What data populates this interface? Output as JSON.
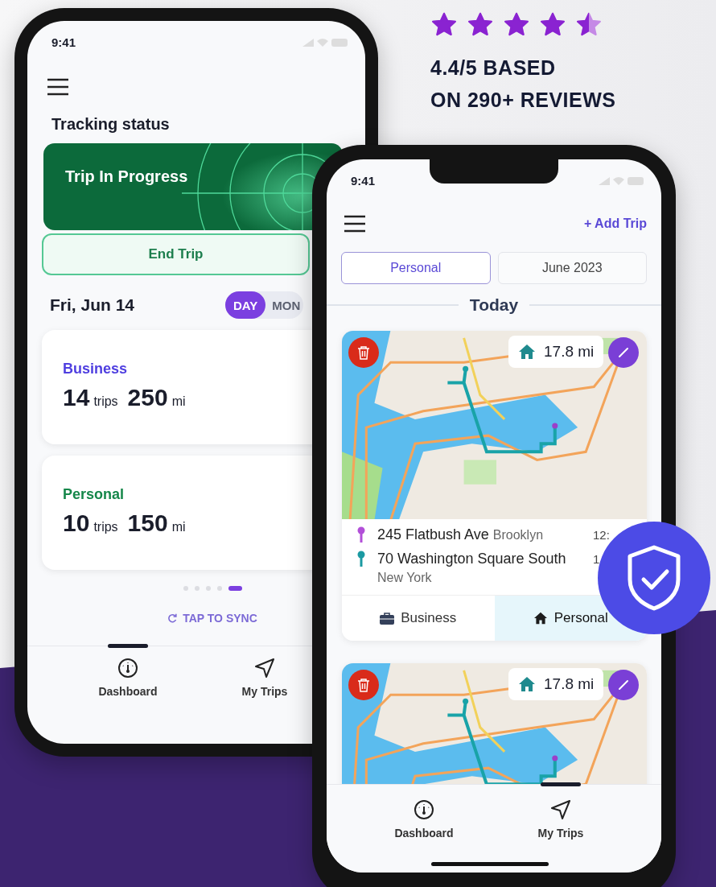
{
  "rating": {
    "stars": 4.5,
    "lines": [
      "4.4/5 BASED",
      "ON 290+ REVIEWS"
    ]
  },
  "dashboard_phone": {
    "time": "9:41",
    "section_title": "Tracking status",
    "status_card": {
      "label": "Trip In Progress"
    },
    "end_button": "End Trip",
    "date": "Fri, Jun 14",
    "period_toggle": [
      {
        "label": "DAY",
        "selected": true
      },
      {
        "label": "MON",
        "selected": false
      }
    ],
    "summaries": [
      {
        "category": "Business",
        "color": "#4f3fe0",
        "trips": "14",
        "trips_unit": "trips",
        "miles": "250",
        "miles_unit": "mi"
      },
      {
        "category": "Personal",
        "color": "#15874a",
        "trips": "10",
        "trips_unit": "trips",
        "miles": "150",
        "miles_unit": "mi"
      }
    ],
    "pager": [
      {
        "selected": false
      },
      {
        "selected": false
      },
      {
        "selected": false
      },
      {
        "selected": false
      },
      {
        "selected": true
      }
    ],
    "sync": "TAP TO SYNC",
    "nav": [
      {
        "label": "Dashboard",
        "kind": "gauge",
        "selected": true
      },
      {
        "label": "My Trips",
        "kind": "arrow",
        "selected": false
      }
    ]
  },
  "trips_phone": {
    "time": "9:41",
    "add_button": "+ Add Trip",
    "filters": [
      {
        "label": "Personal",
        "selected": true
      },
      {
        "label": "June 2023",
        "selected": false
      }
    ],
    "day_heading": "Today",
    "trips": [
      {
        "distance": "17.8 mi",
        "stops": [
          {
            "address": "245 Flatbush Ave",
            "city": "Brooklyn",
            "time": "12:",
            "color": "#b24fd8"
          },
          {
            "address": "70 Washington Square South",
            "city": "New York",
            "time": "1",
            "color": "#1b9aa2"
          }
        ],
        "categories": [
          {
            "label": "Business",
            "kind": "briefcase",
            "selected": false
          },
          {
            "label": "Personal",
            "kind": "home",
            "selected": true
          }
        ]
      },
      {
        "distance": "17.8 mi"
      }
    ],
    "nav": [
      {
        "label": "Dashboard",
        "kind": "gauge",
        "selected": false
      },
      {
        "label": "My Trips",
        "kind": "arrow",
        "selected": true
      }
    ]
  }
}
